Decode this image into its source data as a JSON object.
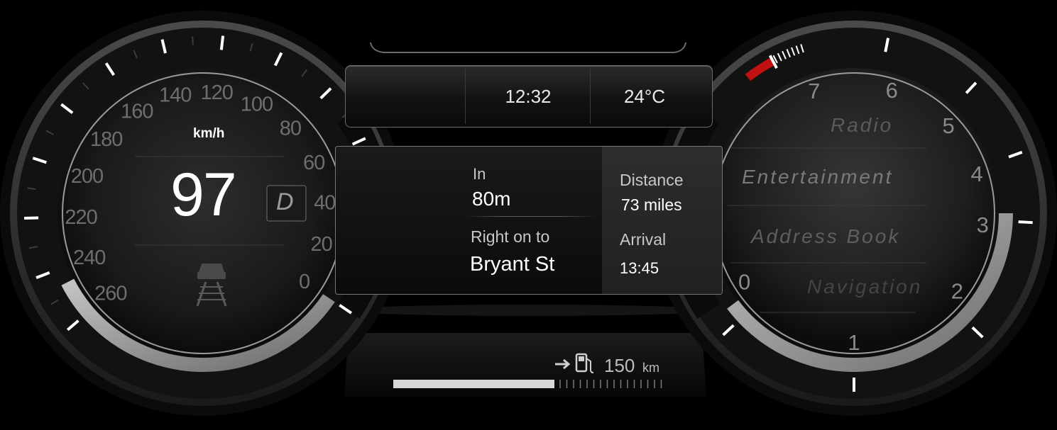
{
  "speedometer": {
    "unit": "km/h",
    "speed": "97",
    "gear": "D",
    "scale_labels": [
      "0",
      "20",
      "40",
      "60",
      "80",
      "100",
      "120",
      "140",
      "160",
      "180",
      "200",
      "220",
      "240",
      "260"
    ]
  },
  "tachometer": {
    "scale_labels": [
      "0",
      "1",
      "2",
      "3",
      "4",
      "5",
      "6",
      "7"
    ]
  },
  "status_bar": {
    "weather_icon": "sun-icon",
    "time": "12:32",
    "temperature": "24°C"
  },
  "navigation": {
    "turn_icon": "turn-right-arrow-icon",
    "in_label": "In",
    "in_distance": "80m",
    "instruction": "Right on to",
    "street": "Bryant St",
    "distance_label": "Distance",
    "distance_value": "73 miles",
    "arrival_label": "Arrival",
    "arrival_value": "13:45"
  },
  "menu": {
    "items": [
      "Radio",
      "Entertainment",
      "Address Book",
      "Navigation"
    ]
  },
  "fuel": {
    "icon": "fuel-pump-icon",
    "range_value": "150",
    "range_unit": "km",
    "level_fraction": 0.6
  },
  "colors": {
    "redline": "#c01010",
    "text_primary": "#ffffff",
    "text_secondary": "#bcbcbc",
    "menu_text": "#6a6a6a"
  }
}
